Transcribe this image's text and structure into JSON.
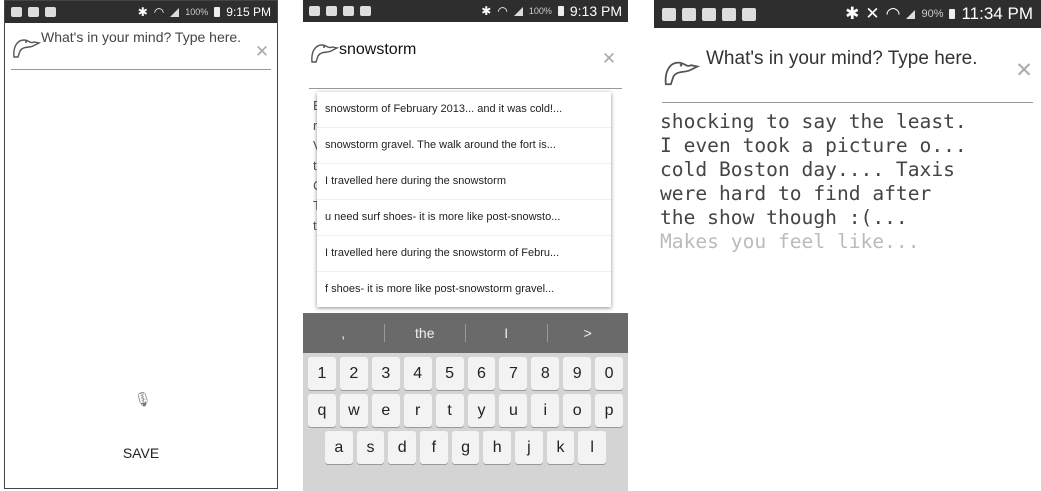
{
  "screen1": {
    "status": {
      "battery_pct": "100%",
      "time": "9:15 PM"
    },
    "search": {
      "placeholder": "What's in your mind? Type here."
    },
    "save_label": "SAVE"
  },
  "screen2": {
    "status": {
      "battery_pct": "100%",
      "time": "9:13 PM"
    },
    "search": {
      "query": "snowstorm"
    },
    "background_letters": [
      "E",
      "r",
      "V",
      "t",
      "C",
      "T",
      "t"
    ],
    "suggestions": [
      "snowstorm of February 2013... and it was cold!...",
      "snowstorm gravel. The walk around the fort is...",
      "I travelled here during the snowstorm",
      "u need surf shoes- it is more like post-snowsto...",
      "I travelled here during the snowstorm of Febru...",
      "f shoes- it is more like post-snowstorm gravel..."
    ],
    "keyboard": {
      "suggestions": [
        ",",
        "the",
        "I",
        ">"
      ],
      "rows": [
        [
          "1",
          "2",
          "3",
          "4",
          "5",
          "6",
          "7",
          "8",
          "9",
          "0"
        ],
        [
          "q",
          "w",
          "e",
          "r",
          "t",
          "y",
          "u",
          "i",
          "o",
          "p"
        ],
        [
          "a",
          "s",
          "d",
          "f",
          "g",
          "h",
          "j",
          "k",
          "l"
        ]
      ]
    }
  },
  "screen3": {
    "status": {
      "battery_pct": "90%",
      "time": "11:34 PM"
    },
    "search": {
      "placeholder": "What's in your mind? Type here."
    },
    "result_lines": [
      "shocking to say the least.",
      "I even took a picture o...",
      "cold Boston day.... Taxis",
      "were hard to find after",
      "the show though :(...",
      "Makes you feel like..."
    ]
  },
  "colors": {
    "statusbar": "#2e2e2e",
    "suggestion_strip": "#6a6a6a",
    "keyboard_bg": "#d4d4d4"
  },
  "icons": [
    "duck-logo-icon",
    "clear-icon",
    "mic-icon",
    "wifi-icon",
    "battery-icon",
    "signal-icon"
  ]
}
